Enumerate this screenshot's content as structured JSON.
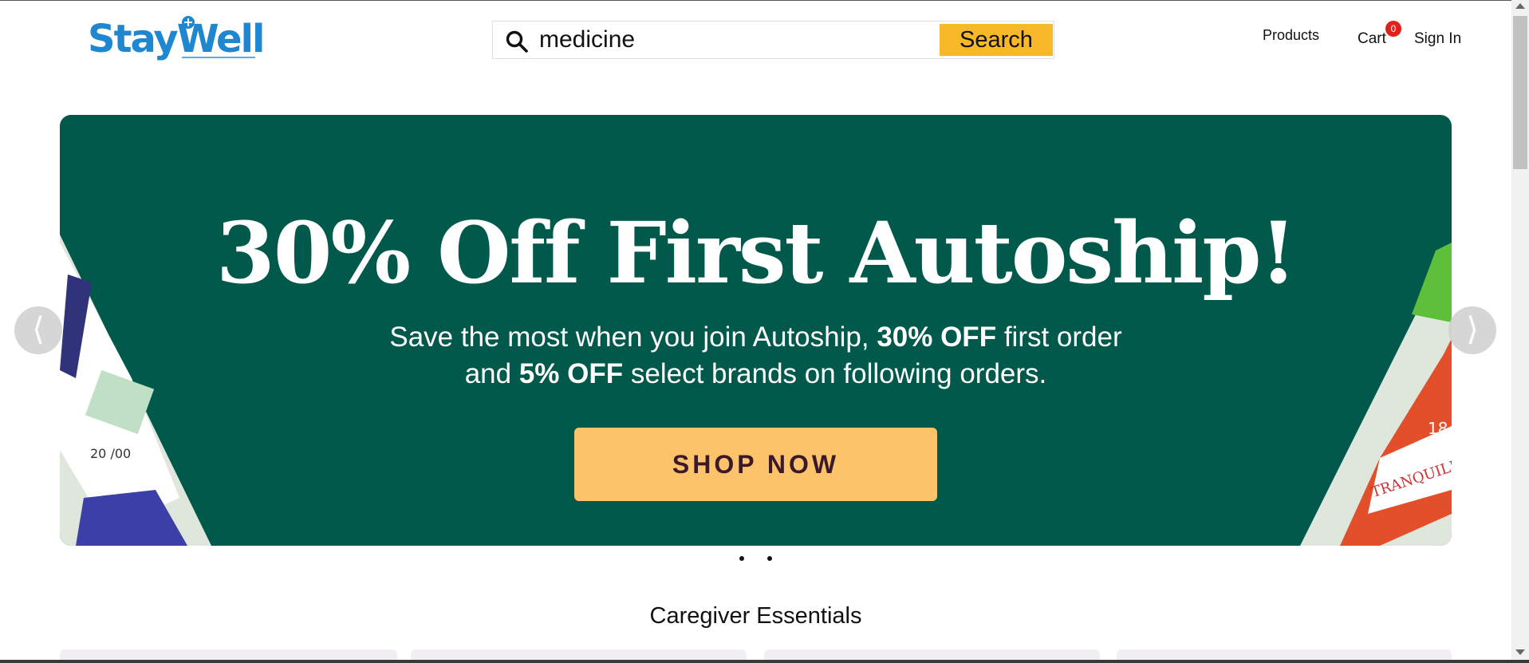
{
  "header": {
    "logo_text": "StayWell",
    "logo_color": "#1f87cf",
    "search": {
      "value": "medicine",
      "placeholder": "",
      "button_label": "Search",
      "button_color": "#f8b928"
    },
    "nav": {
      "products_label": "Products",
      "cart_label": "Cart",
      "cart_count": "0",
      "signin_label": "Sign In"
    }
  },
  "hero": {
    "background_color": "#01594c",
    "title": "30% Off First Autoship!",
    "subtitle_line1_a": "Save the most when you join Autoship,",
    "subtitle_line1_bold": "30% OFF",
    "subtitle_line1_b": "first order",
    "subtitle_line2_a": "and",
    "subtitle_line2_bold": "5% OFF",
    "subtitle_line2_b": "select brands on following orders.",
    "cta_label": "SHOP NOW",
    "cta_color": "#fcc36b",
    "prev_glyph": "⟨",
    "next_glyph": "⟩",
    "slides_count": 2
  },
  "sections": {
    "caregiver_title": "Caregiver Essentials"
  }
}
